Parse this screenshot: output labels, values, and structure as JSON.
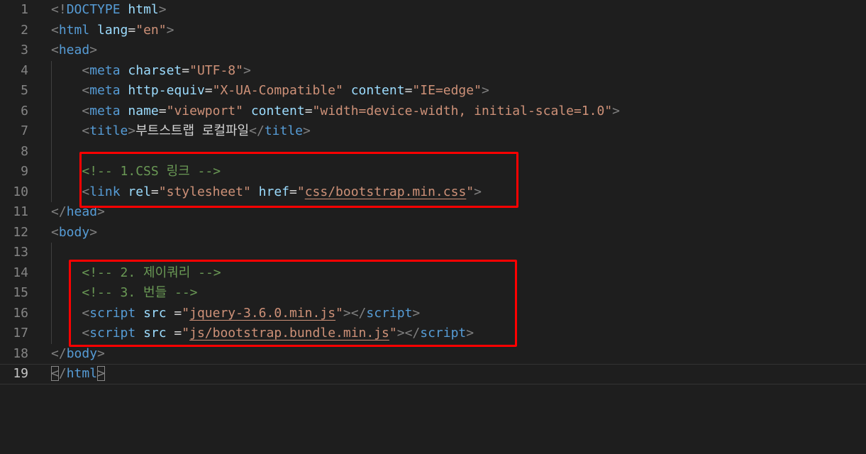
{
  "editor": {
    "current_line": 19,
    "lines": [
      {
        "n": "1",
        "tokens": [
          [
            "punc",
            "<!"
          ],
          [
            "tag",
            "DOCTYPE"
          ],
          [
            "text",
            " "
          ],
          [
            "attr",
            "html"
          ],
          [
            "punc",
            ">"
          ]
        ],
        "indent": 0
      },
      {
        "n": "2",
        "tokens": [
          [
            "punc",
            "<"
          ],
          [
            "tag",
            "html"
          ],
          [
            "text",
            " "
          ],
          [
            "attr",
            "lang"
          ],
          [
            "text",
            "="
          ],
          [
            "str",
            "\"en\""
          ],
          [
            "punc",
            ">"
          ]
        ],
        "indent": 0
      },
      {
        "n": "3",
        "tokens": [
          [
            "punc",
            "<"
          ],
          [
            "tag",
            "head"
          ],
          [
            "punc",
            ">"
          ]
        ],
        "indent": 0
      },
      {
        "n": "4",
        "tokens": [
          [
            "punc",
            "<"
          ],
          [
            "tag",
            "meta"
          ],
          [
            "text",
            " "
          ],
          [
            "attr",
            "charset"
          ],
          [
            "text",
            "="
          ],
          [
            "str",
            "\"UTF-8\""
          ],
          [
            "punc",
            ">"
          ]
        ],
        "indent": 1
      },
      {
        "n": "5",
        "tokens": [
          [
            "punc",
            "<"
          ],
          [
            "tag",
            "meta"
          ],
          [
            "text",
            " "
          ],
          [
            "attr",
            "http-equiv"
          ],
          [
            "text",
            "="
          ],
          [
            "str",
            "\"X-UA-Compatible\""
          ],
          [
            "text",
            " "
          ],
          [
            "attr",
            "content"
          ],
          [
            "text",
            "="
          ],
          [
            "str",
            "\"IE=edge\""
          ],
          [
            "punc",
            ">"
          ]
        ],
        "indent": 1
      },
      {
        "n": "6",
        "tokens": [
          [
            "punc",
            "<"
          ],
          [
            "tag",
            "meta"
          ],
          [
            "text",
            " "
          ],
          [
            "attr",
            "name"
          ],
          [
            "text",
            "="
          ],
          [
            "str",
            "\"viewport\""
          ],
          [
            "text",
            " "
          ],
          [
            "attr",
            "content"
          ],
          [
            "text",
            "="
          ],
          [
            "str",
            "\"width=device-width, initial-scale=1.0\""
          ],
          [
            "punc",
            ">"
          ]
        ],
        "indent": 1
      },
      {
        "n": "7",
        "tokens": [
          [
            "punc",
            "<"
          ],
          [
            "tag",
            "title"
          ],
          [
            "punc",
            ">"
          ],
          [
            "text",
            "부트스트랩 로컬파일"
          ],
          [
            "punc",
            "</"
          ],
          [
            "tag",
            "title"
          ],
          [
            "punc",
            ">"
          ]
        ],
        "indent": 1
      },
      {
        "n": "8",
        "tokens": [],
        "indent": 1
      },
      {
        "n": "9",
        "tokens": [
          [
            "comment",
            "<!-- 1.CSS 링크 -->"
          ]
        ],
        "indent": 1
      },
      {
        "n": "10",
        "tokens": [
          [
            "punc",
            "<"
          ],
          [
            "tag",
            "link"
          ],
          [
            "text",
            " "
          ],
          [
            "attr",
            "rel"
          ],
          [
            "text",
            "="
          ],
          [
            "str",
            "\"stylesheet\""
          ],
          [
            "text",
            " "
          ],
          [
            "attr",
            "href"
          ],
          [
            "text",
            "="
          ],
          [
            "str",
            "\""
          ],
          [
            "link",
            "css/bootstrap.min.css"
          ],
          [
            "str",
            "\""
          ],
          [
            "punc",
            ">"
          ]
        ],
        "indent": 1
      },
      {
        "n": "11",
        "tokens": [
          [
            "punc",
            "</"
          ],
          [
            "tag",
            "head"
          ],
          [
            "punc",
            ">"
          ]
        ],
        "indent": 0
      },
      {
        "n": "12",
        "tokens": [
          [
            "punc",
            "<"
          ],
          [
            "tag",
            "body"
          ],
          [
            "punc",
            ">"
          ]
        ],
        "indent": 0
      },
      {
        "n": "13",
        "tokens": [],
        "indent": 1
      },
      {
        "n": "14",
        "tokens": [
          [
            "comment",
            "<!-- 2. 제이쿼리 -->"
          ]
        ],
        "indent": 1
      },
      {
        "n": "15",
        "tokens": [
          [
            "comment",
            "<!-- 3. 번들 -->"
          ]
        ],
        "indent": 1
      },
      {
        "n": "16",
        "tokens": [
          [
            "punc",
            "<"
          ],
          [
            "tag",
            "script"
          ],
          [
            "text",
            " "
          ],
          [
            "attr",
            "src"
          ],
          [
            "text",
            " ="
          ],
          [
            "str",
            "\""
          ],
          [
            "link",
            "jquery-3.6.0.min.js"
          ],
          [
            "str",
            "\""
          ],
          [
            "punc",
            "></"
          ],
          [
            "tag",
            "script"
          ],
          [
            "punc",
            ">"
          ]
        ],
        "indent": 1
      },
      {
        "n": "17",
        "tokens": [
          [
            "punc",
            "<"
          ],
          [
            "tag",
            "script"
          ],
          [
            "text",
            " "
          ],
          [
            "attr",
            "src"
          ],
          [
            "text",
            " ="
          ],
          [
            "str",
            "\""
          ],
          [
            "link",
            "js/bootstrap.bundle.min.js"
          ],
          [
            "str",
            "\""
          ],
          [
            "punc",
            "></"
          ],
          [
            "tag",
            "script"
          ],
          [
            "punc",
            ">"
          ]
        ],
        "indent": 1
      },
      {
        "n": "18",
        "tokens": [
          [
            "punc",
            "</"
          ],
          [
            "tag",
            "body"
          ],
          [
            "punc",
            ">"
          ]
        ],
        "indent": 0
      },
      {
        "n": "19",
        "tokens": [
          [
            "bracket",
            "<"
          ],
          [
            "punc",
            "/"
          ],
          [
            "tag",
            "html"
          ],
          [
            "bracket",
            ">"
          ]
        ],
        "indent": 0
      }
    ]
  },
  "colors": {
    "background": "#1e1e1e",
    "line_number": "#858585",
    "punctuation": "#808080",
    "tag": "#569cd6",
    "attribute": "#9cdcfe",
    "string": "#ce9178",
    "text": "#d4d4d4",
    "comment": "#6a9955",
    "highlight_box": "#ff0000"
  }
}
